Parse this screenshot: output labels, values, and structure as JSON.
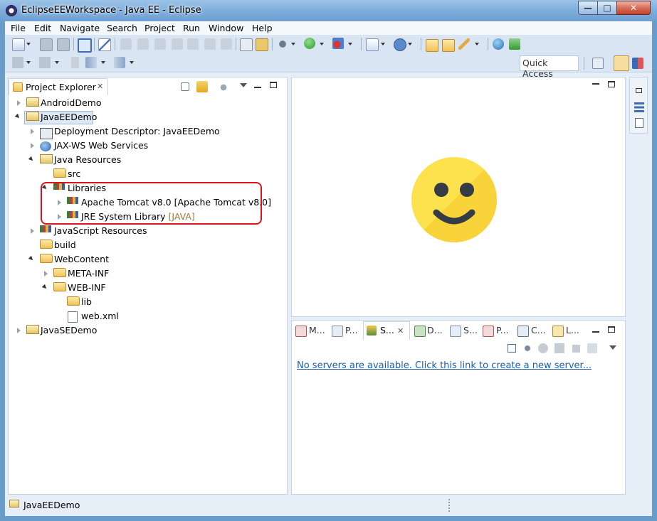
{
  "window": {
    "title": "EclipseEEWorkspace - Java EE - Eclipse",
    "controls": {
      "minimize": "—",
      "maximize": "□",
      "close": "✕"
    }
  },
  "menu": [
    "File",
    "Edit",
    "Navigate",
    "Search",
    "Project",
    "Run",
    "Window",
    "Help"
  ],
  "quick_access": {
    "placeholder": "Quick Access"
  },
  "explorer": {
    "tab_label": "Project Explorer",
    "tree": [
      {
        "label": "AndroidDemo",
        "icon": "android-project-icon",
        "expanded": false
      },
      {
        "label": "JavaEEDemo",
        "icon": "web-project-icon",
        "expanded": true,
        "selected": true
      },
      {
        "label": "Deployment Descriptor: JavaEEDemo",
        "icon": "deployment-descriptor-icon",
        "expanded": false
      },
      {
        "label": "JAX-WS Web Services",
        "icon": "web-services-icon",
        "expanded": false
      },
      {
        "label": "Java Resources",
        "icon": "java-resources-icon",
        "expanded": true
      },
      {
        "label": "src",
        "icon": "source-folder-icon"
      },
      {
        "label": "Libraries",
        "icon": "library-icon",
        "expanded": true
      },
      {
        "label": "Apache Tomcat v8.0 [Apache Tomcat v8.0]",
        "icon": "library-icon",
        "expanded": false
      },
      {
        "label": "JRE System Library",
        "suffix": "[JAVA]",
        "icon": "library-icon",
        "expanded": false
      },
      {
        "label": "JavaScript Resources",
        "icon": "javascript-resources-icon",
        "expanded": false
      },
      {
        "label": "build",
        "icon": "folder-icon"
      },
      {
        "label": "WebContent",
        "icon": "folder-icon",
        "expanded": true
      },
      {
        "label": "META-INF",
        "icon": "folder-icon",
        "expanded": false
      },
      {
        "label": "WEB-INF",
        "icon": "folder-icon",
        "expanded": true
      },
      {
        "label": "lib",
        "icon": "folder-icon"
      },
      {
        "label": "web.xml",
        "icon": "xml-file-icon"
      },
      {
        "label": "JavaSEDemo",
        "icon": "java-project-icon",
        "expanded": false
      }
    ]
  },
  "bottom_panel": {
    "tabs": [
      {
        "label": "M...",
        "icon": "markers-icon"
      },
      {
        "label": "P...",
        "icon": "properties-icon"
      },
      {
        "label": "S...",
        "icon": "servers-icon",
        "active": true
      },
      {
        "label": "D...",
        "icon": "data-source-icon"
      },
      {
        "label": "S...",
        "icon": "snippets-icon"
      },
      {
        "label": "P...",
        "icon": "problems-icon"
      },
      {
        "label": "C...",
        "icon": "console-icon"
      },
      {
        "label": "L...",
        "icon": "log-icon"
      }
    ],
    "servers_message": "No servers are available. Click this link to create a new server..."
  },
  "status": {
    "selection": "JavaEEDemo"
  },
  "colors": {
    "highlight": "#d9151b",
    "link": "#1a5ea8",
    "smiley": "#fcd33f"
  }
}
